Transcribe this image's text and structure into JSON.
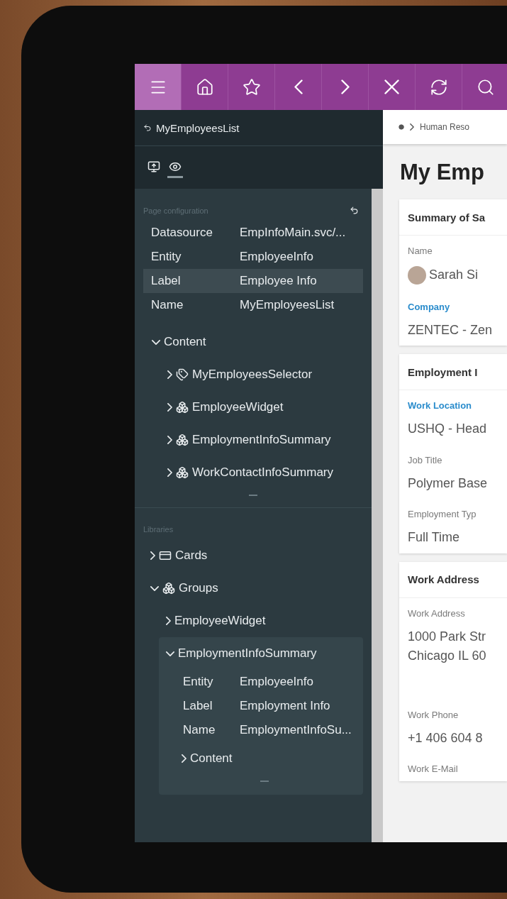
{
  "toolbar": [
    {
      "kind": "menu",
      "selected": true
    },
    {
      "kind": "home",
      "selected": false
    },
    {
      "kind": "star",
      "selected": false
    },
    {
      "kind": "back",
      "selected": false
    },
    {
      "kind": "forward",
      "selected": false
    },
    {
      "kind": "close",
      "selected": false
    },
    {
      "kind": "refresh",
      "selected": false
    },
    {
      "kind": "search",
      "selected": false
    }
  ],
  "designer": {
    "page_name": "MyEmployeesList",
    "view_tabs": [
      {
        "kind": "publish",
        "selected": false
      },
      {
        "kind": "preview",
        "selected": true
      }
    ],
    "page_config": {
      "heading": "Page configuration",
      "properties": [
        {
          "name": "Datasource",
          "value": "EmpInfoMain.svc/...",
          "selected": false
        },
        {
          "name": "Entity",
          "value": "EmployeeInfo",
          "selected": false
        },
        {
          "name": "Label",
          "value": "Employee Info",
          "selected": true
        },
        {
          "name": "Name",
          "value": "MyEmployeesList",
          "selected": false
        }
      ],
      "tree": [
        {
          "label": "Content",
          "expanded": true,
          "children": [
            {
              "label": "MyEmployeesSelector",
              "kind": "selector",
              "expanded": false
            },
            {
              "label": "EmployeeWidget",
              "kind": "group",
              "expanded": false
            },
            {
              "label": "EmploymentInfoSummary",
              "kind": "group",
              "expanded": false
            },
            {
              "label": "WorkContactInfoSummary",
              "kind": "group",
              "expanded": false
            }
          ]
        }
      ]
    },
    "libraries": {
      "heading": "Libraries",
      "tree": [
        {
          "label": "Cards",
          "kind": "card",
          "expanded": false
        },
        {
          "label": "Groups",
          "kind": "group",
          "expanded": true,
          "children": [
            {
              "label": "EmployeeWidget",
              "expanded": false
            },
            {
              "label": "EmploymentInfoSummary",
              "expanded": true,
              "selected": true,
              "properties": [
                {
                  "name": "Entity",
                  "value": "EmployeeInfo"
                },
                {
                  "name": "Label",
                  "value": "Employment Info"
                },
                {
                  "name": "Name",
                  "value": "EmploymentInfoSu..."
                }
              ],
              "children": [
                {
                  "label": "Content",
                  "expanded": false
                }
              ]
            }
          ]
        }
      ]
    }
  },
  "main": {
    "breadcrumb": [
      "Human Reso"
    ],
    "title": "My Emp",
    "cards": [
      {
        "title": "Summary of Sa",
        "fields": [
          {
            "label": "Name",
            "color": "#7a7a7a",
            "kind": "person",
            "lines": [
              "Sarah Si"
            ]
          },
          {
            "label": "Company",
            "color": "#2a8ccc",
            "kind": "text",
            "lines": [
              "ZENTEC - Zen"
            ]
          }
        ]
      },
      {
        "title": "Employment I",
        "fields": [
          {
            "label": "Work Location",
            "color": "#2a8ccc",
            "kind": "text",
            "lines": [
              "USHQ - Head"
            ]
          },
          {
            "label": "Job Title",
            "color": "#7a7a7a",
            "kind": "text",
            "lines": [
              "Polymer Base"
            ]
          },
          {
            "label": "Employment Typ",
            "color": "#7a7a7a",
            "kind": "text",
            "lines": [
              "Full Time"
            ]
          }
        ]
      },
      {
        "title": "Work Address",
        "fields": [
          {
            "label": "Work Address",
            "color": "#7a7a7a",
            "kind": "address",
            "lines": [
              "1000 Park Str",
              "Chicago IL 60"
            ]
          },
          {
            "label": "Work Phone",
            "color": "#7a7a7a",
            "kind": "text",
            "lines": [
              "+1 406 604 8"
            ]
          },
          {
            "label": "Work E-Mail",
            "color": "#7a7a7a",
            "kind": "label"
          }
        ]
      }
    ]
  }
}
